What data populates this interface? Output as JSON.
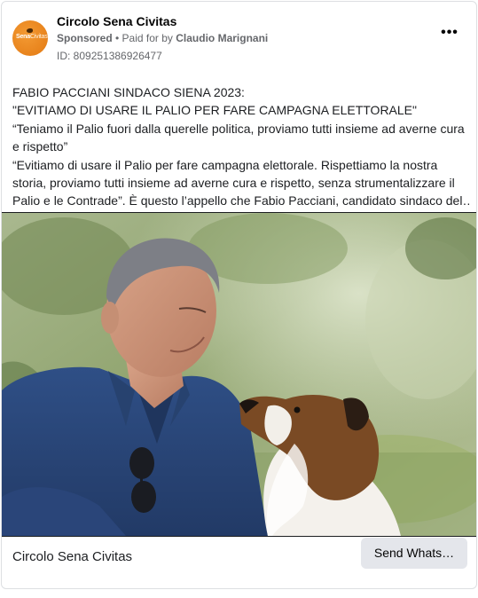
{
  "post": {
    "page_name": "Circolo Sena Civitas",
    "sponsored_label": "Sponsored",
    "separator": " • ",
    "paid_for_prefix": "Paid for by ",
    "payer": "Claudio Marignani",
    "ad_id": "ID: 809251386926477",
    "more_glyph": "•••",
    "avatar_logo": {
      "text_bold": "Sena",
      "text_thin": "Civitas"
    },
    "body_lines": [
      "FABIO PACCIANI SINDACO SIENA 2023:",
      "\"EVITIAMO DI USARE IL PALIO PER FARE CAMPAGNA ELETTORALE\"",
      "“Teniamo il Palio fuori dalla querelle politica, proviamo tutti insieme ad averne cura",
      "e rispetto”",
      "“Evitiamo di usare il Palio per fare campagna elettorale. Rispettiamo la nostra",
      "storia, proviamo tutti insieme ad averne cura e rispetto, senza strumentalizzare il",
      "Palio e le Contrade”. È questo l’appello che Fabio Pacciani, candidato sindaco del…"
    ]
  },
  "footer": {
    "page_name": "Circolo Sena Civitas",
    "cta_label": "Send Whats…"
  },
  "colors": {
    "avatar_orange": "#e8831c",
    "secondary_text": "#65676b",
    "button_bg": "#e4e6eb",
    "border": "#dddfe2"
  },
  "icons": {
    "more": "more-options-icon"
  }
}
